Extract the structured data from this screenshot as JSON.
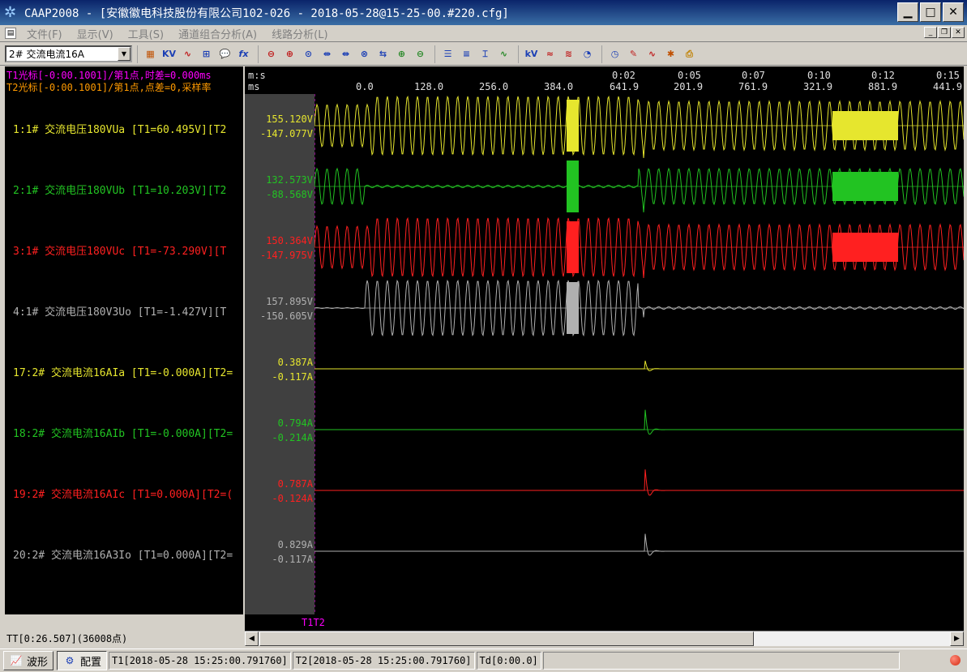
{
  "window": {
    "title": "CAAP2008 - [安徽徽电科技股份有限公司102-026 - 2018-05-28@15-25-00.#220.cfg]",
    "app_icon": "app-logo-icon",
    "buttons": {
      "minimize": "minimize-icon",
      "maximize": "maximize-icon",
      "close": "close-icon"
    }
  },
  "menu": {
    "items": [
      "文件(F)",
      "显示(V)",
      "工具(S)",
      "通道组合分析(A)",
      "线路分析(L)"
    ]
  },
  "toolbar": {
    "channel_select": "2# 交流电流16A"
  },
  "cursors": {
    "t1": "T1光标[-0:00.1001]/第1点,时差=0.000ms",
    "t2": "T2光标[-0:00.1001]/第1点,点差=0,采样率",
    "tag": "T1T2"
  },
  "time_axis": {
    "units": [
      "m:s",
      "ms"
    ],
    "ticks_top": [
      "0:02",
      "0:05",
      "0:07",
      "0:10",
      "0:12",
      "0:15"
    ],
    "ticks_bottom": [
      "0.0",
      "128.0",
      "256.0",
      "384.0",
      "641.9",
      "201.9",
      "761.9",
      "321.9",
      "881.9",
      "441.9"
    ]
  },
  "channels": [
    {
      "label": "1:1# 交流电压180VUa [T1=60.495V][T2",
      "max": "155.120V",
      "min": "-147.077V",
      "color": "#e6e62e"
    },
    {
      "label": "2:1# 交流电压180VUb [T1=10.203V][T2",
      "max": "132.573V",
      "min": "-88.568V",
      "color": "#22c322"
    },
    {
      "label": "3:1# 交流电压180VUc [T1=-73.290V][T",
      "max": "150.364V",
      "min": "-147.975V",
      "color": "#ff2020"
    },
    {
      "label": "4:1# 交流电压180V3Uo [T1=-1.427V][T",
      "max": "157.895V",
      "min": "-150.605V",
      "color": "#b0b0b0"
    },
    {
      "label": "17:2# 交流电流16AIa [T1=-0.000A][T2=",
      "max": "0.387A",
      "min": "-0.117A",
      "color": "#e6e62e"
    },
    {
      "label": "18:2# 交流电流16AIb [T1=-0.000A][T2=",
      "max": "0.794A",
      "min": "-0.214A",
      "color": "#22c322"
    },
    {
      "label": "19:2# 交流电流16AIc [T1=0.000A][T2=(",
      "max": "0.787A",
      "min": "-0.124A",
      "color": "#ff2020"
    },
    {
      "label": "20:2# 交流电流16A3Io [T1=0.000A][T2=",
      "max": "0.829A",
      "min": "-0.117A",
      "color": "#b0b0b0"
    }
  ],
  "left_status": "TT[0:26.507](36008点)",
  "status": {
    "tab_wave": "波形",
    "tab_config": "配置",
    "t1": "T1[2018-05-28 15:25:00.791760]",
    "t2": "T2[2018-05-28 15:25:00.791760]",
    "td": "Td[0:00.0]"
  }
}
